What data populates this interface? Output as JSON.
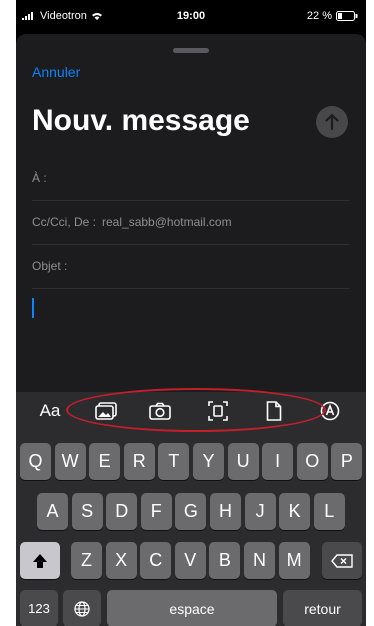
{
  "status_bar": {
    "carrier": "Videotron",
    "time": "19:00",
    "battery": "22 %"
  },
  "compose": {
    "cancel_label": "Annuler",
    "title": "Nouv. message",
    "to_label": "À :",
    "cc_label": "Cc/Cci, De :",
    "from_value": "real_sabb@hotmail.com",
    "subject_label": "Objet :"
  },
  "keyboard": {
    "format_label": "Aa",
    "row1": [
      "Q",
      "W",
      "E",
      "R",
      "T",
      "Y",
      "U",
      "I",
      "O",
      "P"
    ],
    "row2": [
      "A",
      "S",
      "D",
      "F",
      "G",
      "H",
      "J",
      "K",
      "L"
    ],
    "row3": [
      "Z",
      "X",
      "C",
      "V",
      "B",
      "N",
      "M"
    ],
    "numbers_label": "123",
    "space_label": "espace",
    "return_label": "retour"
  },
  "colors": {
    "accent": "#0a84ff",
    "highlight": "#c21f2b"
  }
}
